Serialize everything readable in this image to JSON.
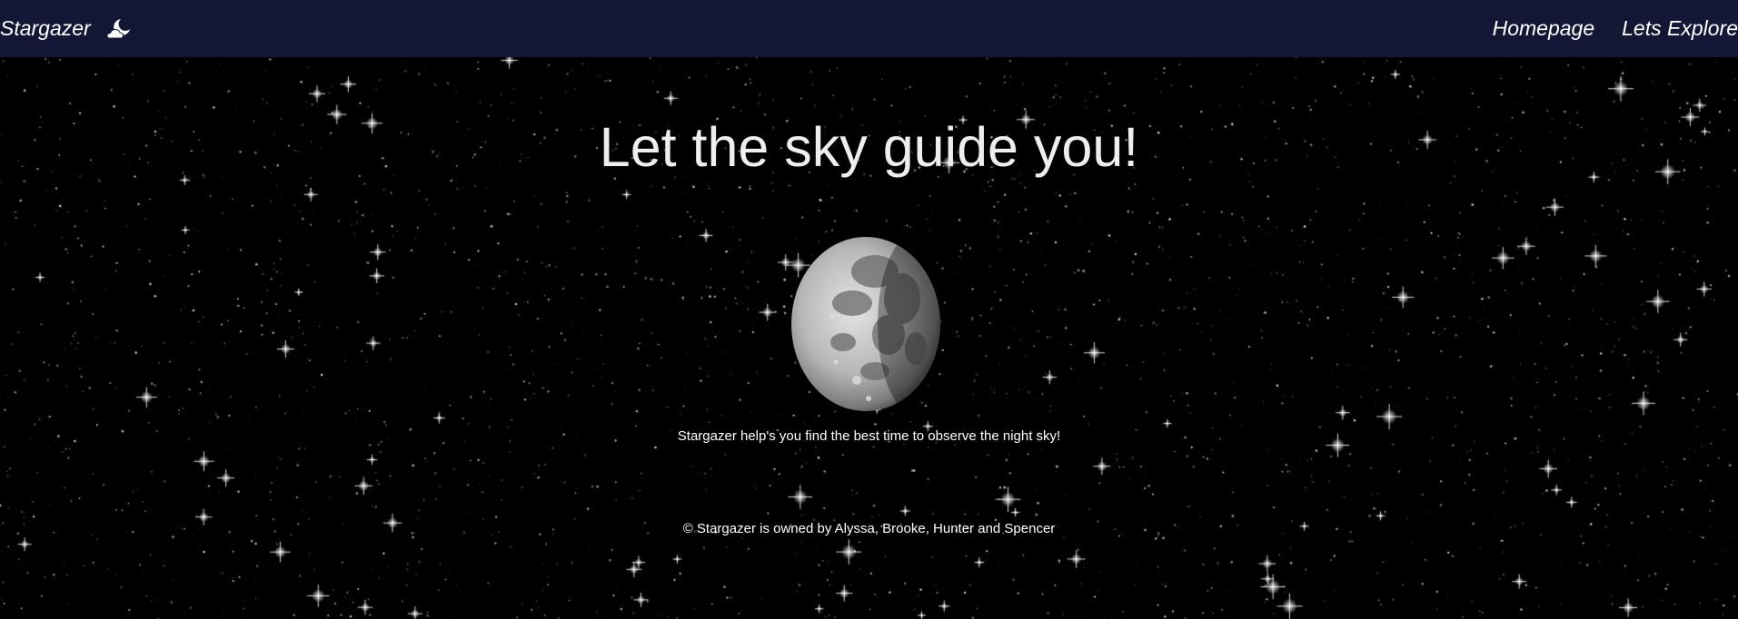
{
  "navbar": {
    "brand_label": "Stargazer",
    "brand_icon": "moon-cloud-icon",
    "links": [
      {
        "label": "Homepage"
      },
      {
        "label": "Lets Explore"
      }
    ],
    "background": "#131735"
  },
  "hero": {
    "headline": "Let the sky guide you!",
    "moon_image": "moon-icon",
    "tagline": "Stargazer help's you find the best time to observe the night sky!"
  },
  "footer": {
    "copyright": "© Stargazer is owned by Alyssa, Brooke, Hunter and Spencer"
  }
}
